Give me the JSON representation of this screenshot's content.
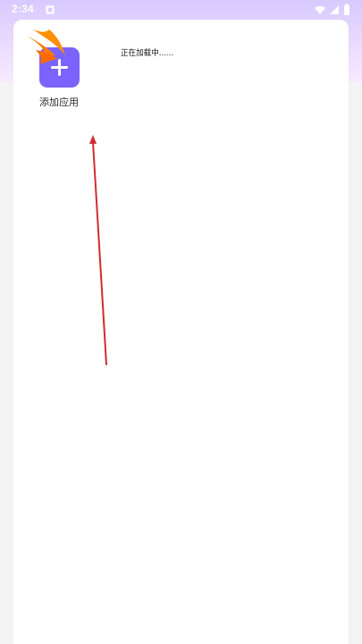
{
  "status_bar": {
    "time": "2:34"
  },
  "app_grid": {
    "add_app_label": "添加应用"
  },
  "loading": {
    "text": "正在加载中......"
  },
  "colors": {
    "accent": "#7a63ff",
    "arrow": "#d12b2f",
    "swift": "#ff7a00"
  },
  "icons": {
    "add": "plus-icon",
    "wifi": "wifi-icon",
    "signal": "signal-icon",
    "battery": "battery-icon",
    "notification": "notification-icon",
    "swift": "swift-logo-icon",
    "annotation": "annotation-arrow-icon"
  }
}
